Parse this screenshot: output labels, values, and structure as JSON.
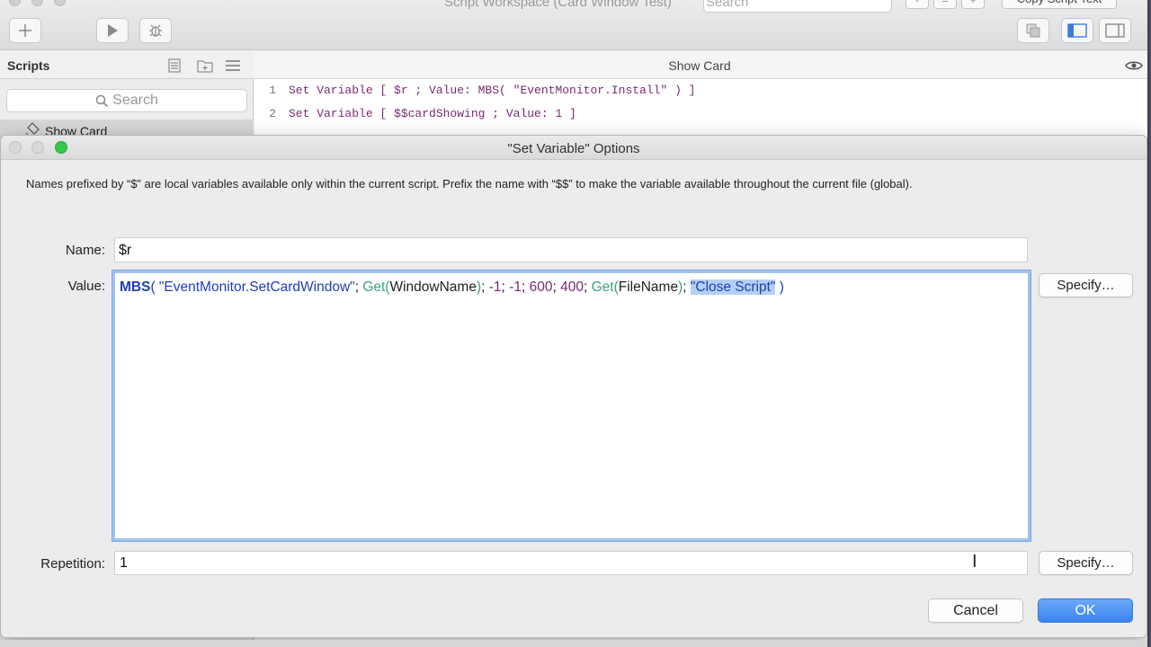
{
  "workspace": {
    "title": "Script Workspace (Card Window Test)",
    "search_placeholder": "Search",
    "zoom_buttons": [
      "-",
      "=",
      "+"
    ],
    "copy_script_label": "Copy Script Text",
    "sidebar": {
      "header": "Scripts",
      "search_placeholder": "Search",
      "script_item": "Show Card"
    },
    "editor": {
      "title": "Show Card",
      "lines": [
        {
          "num": "1",
          "text": "Set Variable [ $r ; Value: MBS( \"EventMonitor.Install\" ) ]"
        },
        {
          "num": "2",
          "text": "Set Variable [ $$cardShowing ; Value: 1 ]"
        }
      ]
    }
  },
  "dialog": {
    "title": "\"Set Variable\" Options",
    "description": "Names prefixed by “$” are local variables available only within the current script. Prefix the name with “$$” to make the variable available throughout the current file (global).",
    "name_label": "Name:",
    "name_value": "$r",
    "value_label": "Value:",
    "value_tokens": {
      "func": "MBS",
      "open": "( ",
      "str1": "\"EventMonitor.SetCardWindow\"",
      "sep1": "; ",
      "get1": "Get(",
      "arg1": "WindowName",
      "close1": ")",
      "sep2": "; ",
      "n1": "-1",
      "sep3": "; ",
      "n2": "-1",
      "sep4": "; ",
      "n3": "600",
      "sep5": "; ",
      "n4": "400",
      "sep6": "; ",
      "get2": "Get(",
      "arg2": "FileName",
      "close2": ")",
      "sep7": "; ",
      "sel": "\"Close Script\"",
      "end": " )"
    },
    "repetition_label": "Repetition:",
    "repetition_value": "1",
    "specify_label": "Specify…",
    "cancel_label": "Cancel",
    "ok_label": "OK"
  },
  "colors": {
    "accent": "#3b83f0",
    "function_blue": "#1f3eb3",
    "get_green": "#3aa27a",
    "number_purple": "#7a2a72",
    "selection": "#b4d0f6"
  }
}
